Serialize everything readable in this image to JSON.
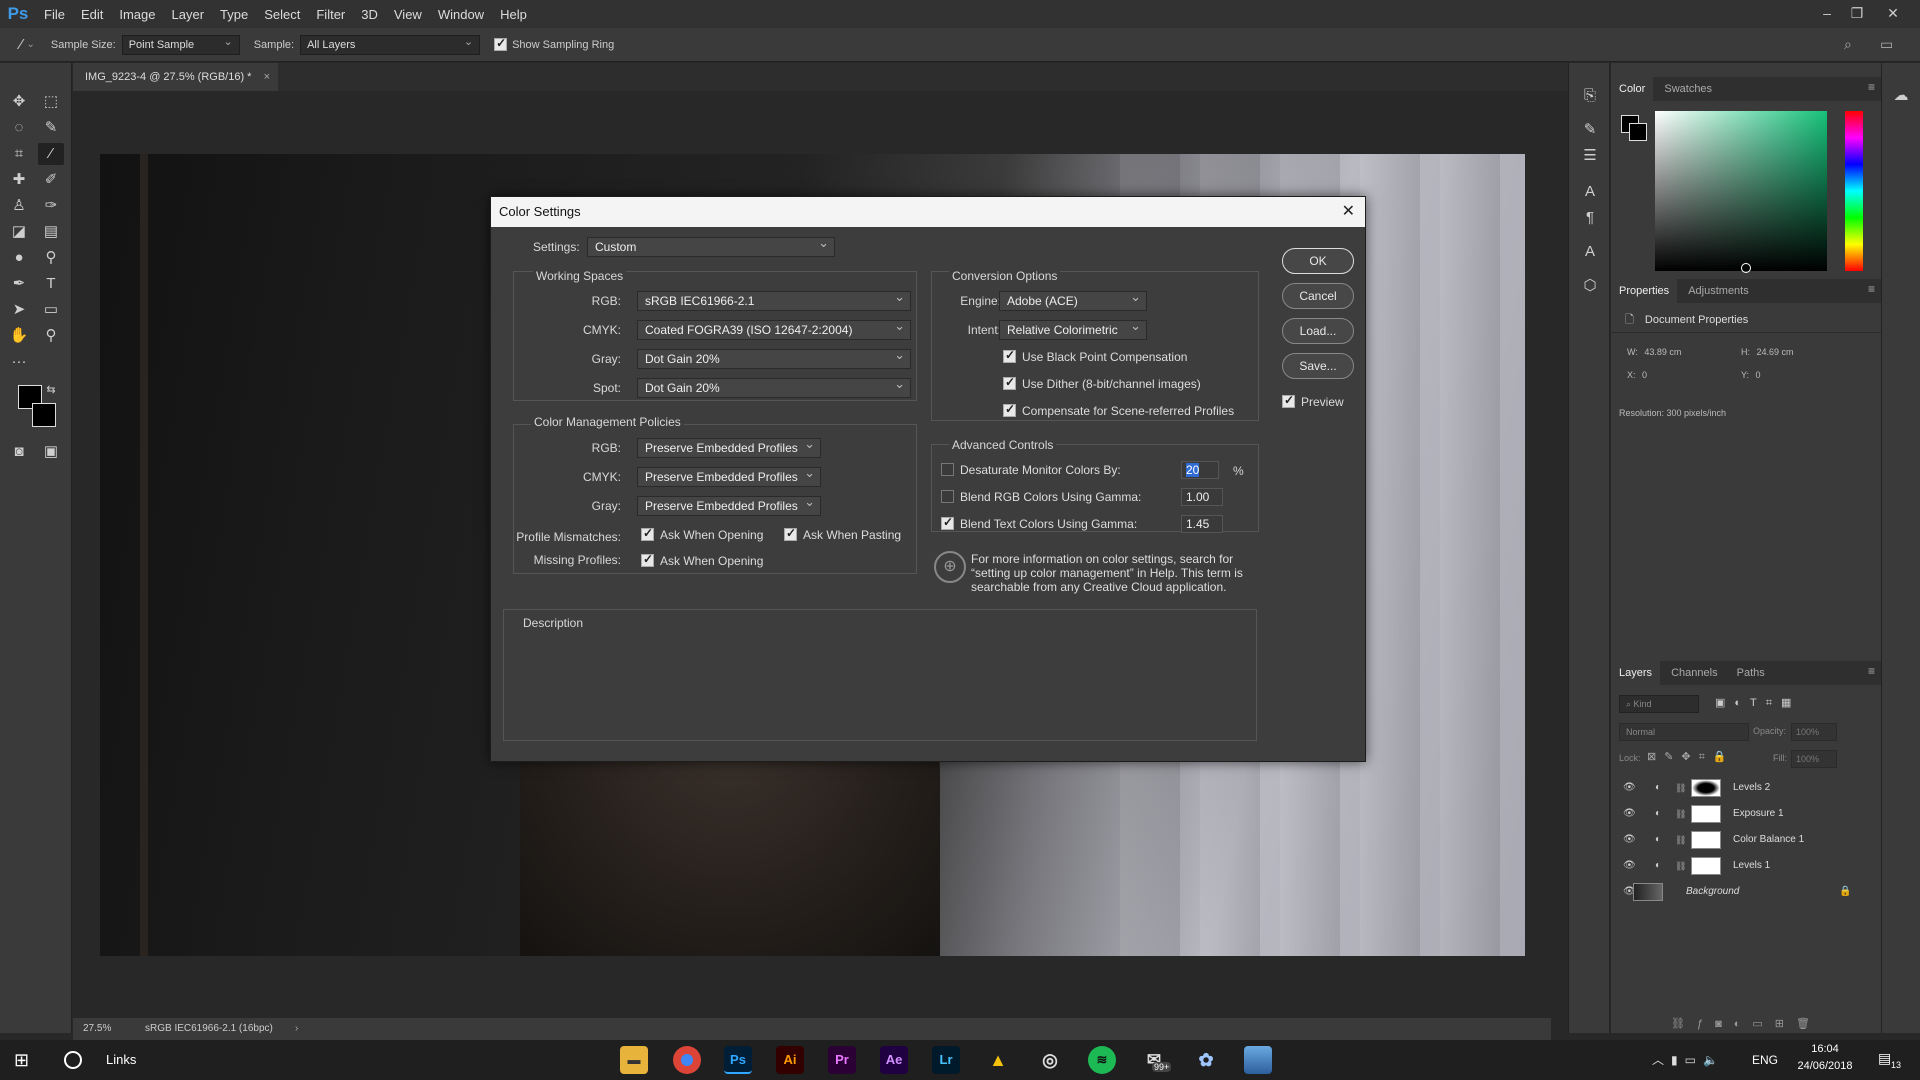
{
  "app": {
    "logo": "Ps"
  },
  "menu": [
    "File",
    "Edit",
    "Image",
    "Layer",
    "Type",
    "Select",
    "Filter",
    "3D",
    "View",
    "Window",
    "Help"
  ],
  "options": {
    "sample_size_label": "Sample Size:",
    "sample_size_value": "Point Sample",
    "sample_label": "Sample:",
    "sample_value": "All Layers",
    "show_ring_label": "Show Sampling Ring"
  },
  "document": {
    "tab_title": "IMG_9223-4 @ 27.5% (RGB/16) *",
    "zoom": "27.5%",
    "profile": "sRGB IEC61966-2.1 (16bpc)"
  },
  "color_panel": {
    "tabs": [
      "Color",
      "Swatches"
    ]
  },
  "properties_panel": {
    "tabs": [
      "Properties",
      "Adjustments"
    ],
    "title": "Document Properties",
    "w_label": "W:",
    "w_value": "43.89 cm",
    "h_label": "H:",
    "h_value": "24.69 cm",
    "x_label": "X:",
    "x_value": "0",
    "y_label": "Y:",
    "y_value": "0",
    "resolution": "Resolution: 300 pixels/inch"
  },
  "layers_panel": {
    "tabs": [
      "Layers",
      "Channels",
      "Paths"
    ],
    "kind_placeholder": "Kind",
    "blend_mode": "Normal",
    "opacity_label": "Opacity:",
    "opacity_value": "100%",
    "lock_label": "Lock:",
    "fill_label": "Fill:",
    "fill_value": "100%",
    "layers": [
      "Levels 2",
      "Exposure 1",
      "Color Balance 1",
      "Levels 1",
      "Background"
    ]
  },
  "dialog": {
    "title": "Color Settings",
    "settings_label": "Settings:",
    "settings_value": "Custom",
    "working_spaces": {
      "heading": "Working Spaces",
      "rgb_label": "RGB:",
      "rgb_value": "sRGB IEC61966-2.1",
      "cmyk_label": "CMYK:",
      "cmyk_value": "Coated FOGRA39 (ISO 12647-2:2004)",
      "gray_label": "Gray:",
      "gray_value": "Dot Gain 20%",
      "spot_label": "Spot:",
      "spot_value": "Dot Gain 20%"
    },
    "policies": {
      "heading": "Color Management Policies",
      "rgb_label": "RGB:",
      "rgb_value": "Preserve Embedded Profiles",
      "cmyk_label": "CMYK:",
      "cmyk_value": "Preserve Embedded Profiles",
      "gray_label": "Gray:",
      "gray_value": "Preserve Embedded Profiles",
      "mismatch_label": "Profile Mismatches:",
      "ask_opening": "Ask When Opening",
      "ask_pasting": "Ask When Pasting",
      "missing_label": "Missing Profiles:",
      "missing_ask_opening": "Ask When Opening"
    },
    "conversion": {
      "heading": "Conversion Options",
      "engine_label": "Engine:",
      "engine_value": "Adobe (ACE)",
      "intent_label": "Intent:",
      "intent_value": "Relative Colorimetric",
      "black_point": "Use Black Point Compensation",
      "dither": "Use Dither (8-bit/channel images)",
      "scene": "Compensate for Scene-referred Profiles"
    },
    "advanced": {
      "heading": "Advanced Controls",
      "desaturate_label": "Desaturate Monitor Colors By:",
      "desaturate_value": "20",
      "desaturate_unit": "%",
      "blend_rgb_label": "Blend RGB Colors Using Gamma:",
      "blend_rgb_value": "1.00",
      "blend_text_label": "Blend Text Colors Using Gamma:",
      "blend_text_value": "1.45"
    },
    "info_text": "For more information on color settings, search for “setting up color management” in Help. This term is searchable from any Creative Cloud application.",
    "description_heading": "Description",
    "buttons": {
      "ok": "OK",
      "cancel": "Cancel",
      "load": "Load...",
      "save": "Save..."
    },
    "preview_label": "Preview"
  },
  "taskbar": {
    "links_label": "Links",
    "app_labels": [
      "Ps",
      "Ai",
      "Pr",
      "Ae",
      "Lr"
    ],
    "badge": "99+",
    "lang": "ENG",
    "time": "16:04",
    "date": "24/06/2018",
    "notif_count": "13"
  }
}
